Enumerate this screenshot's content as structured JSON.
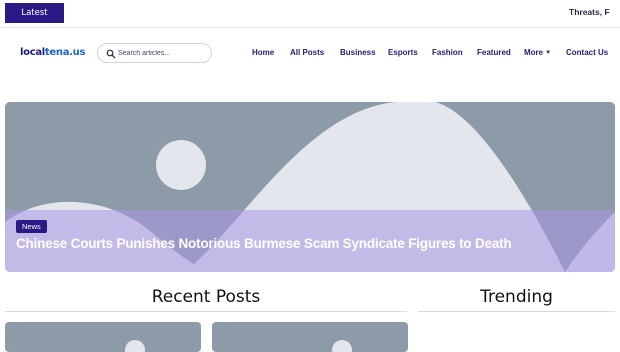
{
  "ticker": {
    "badge_label": "Latest Update",
    "headline": "Threats, Fea"
  },
  "header": {
    "logo": {
      "part_a": "local",
      "part_b": "tena.us"
    },
    "search": {
      "placeholder": "Search articles..."
    },
    "nav": [
      {
        "label": "Home"
      },
      {
        "label": "All Posts"
      },
      {
        "label": "Business"
      },
      {
        "label": "Esports"
      },
      {
        "label": "Fashion"
      },
      {
        "label": "Featured"
      },
      {
        "label": "More",
        "has_dropdown": true
      },
      {
        "label": "Contact Us"
      }
    ]
  },
  "hero": {
    "category": "News",
    "title": "Chinese Courts Punishes Notorious Burmese Scam Syndicate Figures to Death"
  },
  "sections": {
    "recent_posts": "Recent Posts",
    "trending": "Trending"
  },
  "colors": {
    "brand": "#2b1a86",
    "placeholder_bg": "#8d9ba9",
    "placeholder_shape": "#e3e6ec",
    "overlay": "#b7a7ea",
    "nav_text": "#2a1a6e"
  }
}
